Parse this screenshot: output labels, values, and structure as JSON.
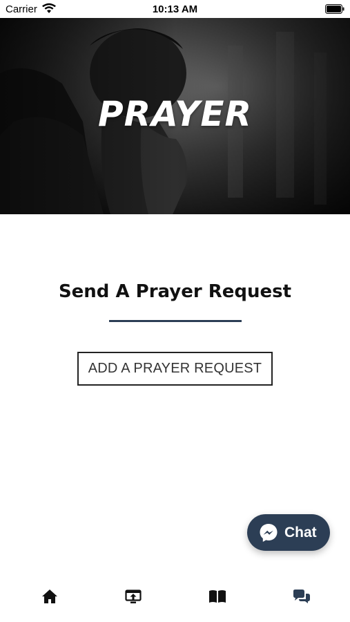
{
  "status_bar": {
    "carrier": "Carrier",
    "time": "10:13 AM",
    "icons": [
      "wifi-icon",
      "battery-icon"
    ]
  },
  "hero": {
    "title": "PRAYER",
    "image": "person-praying-photo"
  },
  "main": {
    "heading": "Send A Prayer Request",
    "button_label": "ADD A PRAYER REQUEST"
  },
  "chat_fab": {
    "label": "Chat",
    "icon": "messenger-icon"
  },
  "bottom_nav": {
    "items": [
      {
        "icon": "home-icon",
        "active": false
      },
      {
        "icon": "upload-screen-icon",
        "active": false
      },
      {
        "icon": "book-icon",
        "active": false
      },
      {
        "icon": "chat-bubbles-icon",
        "active": true
      }
    ]
  },
  "colors": {
    "accent": "#2c3e55",
    "text": "#111111",
    "nav_icon": "#111111",
    "nav_active": "#2c3e55"
  }
}
